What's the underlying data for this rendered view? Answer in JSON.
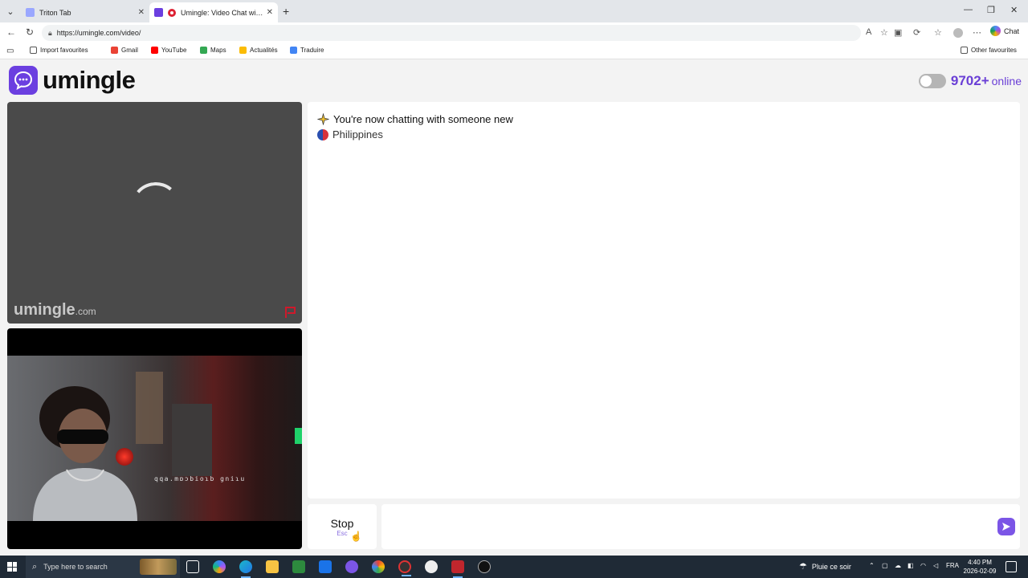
{
  "browser": {
    "tabs": [
      {
        "title": "Triton Tab",
        "active": false
      },
      {
        "title": "Umingle: Video Chat with Stra",
        "active": true
      }
    ],
    "url": "https://umingle.com/video/",
    "chat_label": "Chat",
    "bookmarks": [
      "Import favourites",
      "Gmail",
      "YouTube",
      "Maps",
      "Actualités",
      "Traduire"
    ],
    "other_favourites": "Other favourites"
  },
  "site": {
    "brand": "umingle",
    "online_count": "9702+",
    "online_label": "online"
  },
  "remote_video": {
    "watermark": "umingle",
    "watermark_suffix": ".com"
  },
  "local_video": {
    "overlay_text": "qqa.mɒɔbioɿb gniɿu"
  },
  "chat": {
    "status": "You're now chatting with someone new",
    "country": "Philippines"
  },
  "controls": {
    "stop_label": "Stop",
    "stop_key": "Esc",
    "message_placeholder": ""
  },
  "taskbar": {
    "search_placeholder": "Type here to search",
    "weather": "Pluie ce soir",
    "lang": "FRA",
    "time": "4:40 PM",
    "date": "2026-02-09"
  },
  "colors": {
    "brand": "#6b3fe0",
    "online": "#6a3fd6",
    "send": "#7b55e6"
  }
}
